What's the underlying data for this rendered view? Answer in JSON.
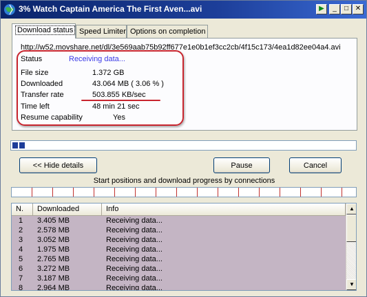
{
  "window": {
    "title": "3% Watch Captain America The First Aven...avi",
    "buttons": {
      "resume": "▶",
      "minimize": "_",
      "maximize": "□",
      "close": "✕"
    }
  },
  "tabs": [
    "Download status",
    "Speed Limiter",
    "Options on completion"
  ],
  "status": {
    "url": "http://w52.movshare.net/dl/3e569aab75b92ff677e1e0b1ef3cc2cb/4f15c173/4ea1d82ee04a4.avi",
    "status_label": "Status",
    "status_value": "Receiving data...",
    "rows": [
      {
        "label": "File size",
        "value": "1.372  GB"
      },
      {
        "label": "Downloaded",
        "value": "43.064  MB  ( 3.06 % )"
      },
      {
        "label": "Transfer rate",
        "value": "503.855  KB/sec"
      },
      {
        "label": "Time left",
        "value": "48 min 21 sec"
      },
      {
        "label": "Resume capability",
        "value": "Yes"
      }
    ]
  },
  "progress": {
    "percent": 3.06
  },
  "buttons": {
    "hide_details": "<< Hide details",
    "pause": "Pause",
    "cancel": "Cancel"
  },
  "connections_caption": "Start positions and download progress by connections",
  "connections": {
    "columns": [
      "N.",
      "Downloaded",
      "Info"
    ],
    "rows": [
      {
        "n": "1",
        "downloaded": "3.405  MB",
        "info": "Receiving data..."
      },
      {
        "n": "2",
        "downloaded": "2.578  MB",
        "info": "Receiving data..."
      },
      {
        "n": "3",
        "downloaded": "3.052  MB",
        "info": "Receiving data..."
      },
      {
        "n": "4",
        "downloaded": "1.975  MB",
        "info": "Receiving data..."
      },
      {
        "n": "5",
        "downloaded": "2.765  MB",
        "info": "Receiving data..."
      },
      {
        "n": "6",
        "downloaded": "3.272  MB",
        "info": "Receiving data..."
      },
      {
        "n": "7",
        "downloaded": "3.187  MB",
        "info": "Receiving data..."
      },
      {
        "n": "8",
        "downloaded": "2.964  MB",
        "info": "Receiving data..."
      }
    ]
  },
  "colors": {
    "annotation": "#c8242d",
    "status_link": "#3a3ae6",
    "list_bg": "#c4b5c4"
  }
}
